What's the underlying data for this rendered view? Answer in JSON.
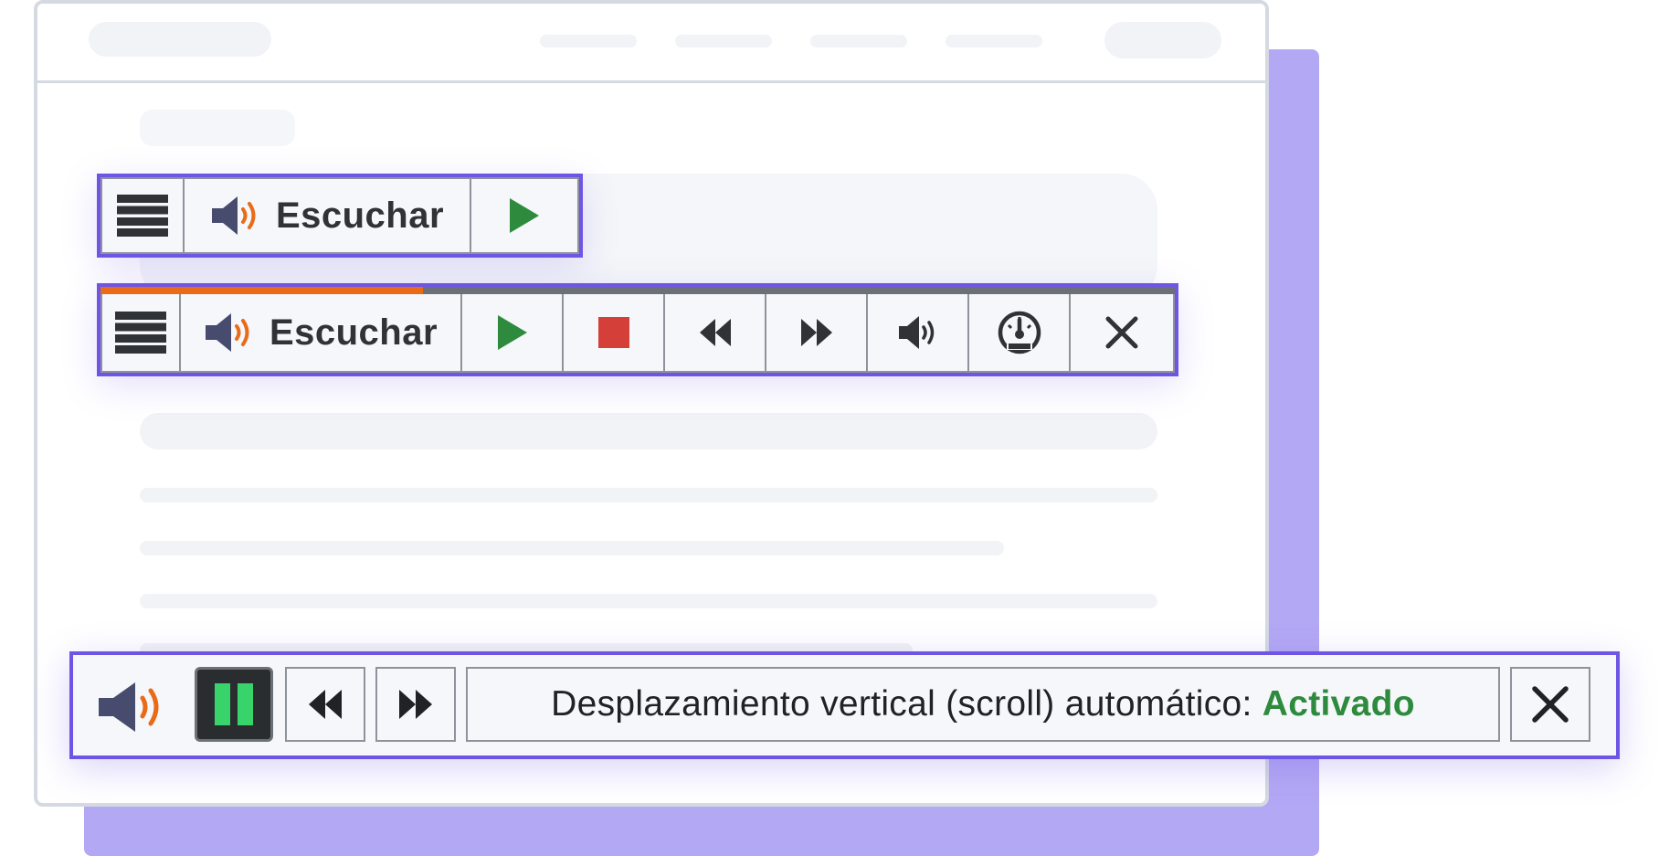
{
  "toolbar_compact": {
    "listen_label": "Escuchar",
    "icons": [
      "menu-icon",
      "speaker-icon",
      "play-icon"
    ]
  },
  "toolbar_expanded": {
    "listen_label": "Escuchar",
    "progress": 0.3,
    "icons": [
      "menu-icon",
      "speaker-icon",
      "play-icon",
      "stop-icon",
      "rewind-icon",
      "fast-forward-icon",
      "volume-icon",
      "speed-gauge-icon",
      "close-icon"
    ]
  },
  "toolbar_scroll": {
    "status_prefix": "Desplazamiento vertical (scroll) automático: ",
    "status_value": "Activado",
    "icons": [
      "speaker-icon",
      "pause-icon",
      "rewind-icon",
      "fast-forward-icon",
      "close-icon"
    ]
  },
  "colors": {
    "accent": "#6f55e6",
    "backdrop": "#b3a8f4",
    "play": "#2e8b3d",
    "stop": "#d43f3a",
    "progress": "#e96b17",
    "pause_green": "#39d36b",
    "status_active": "#2e8b3d",
    "speaker_wave": "#e96b17"
  }
}
